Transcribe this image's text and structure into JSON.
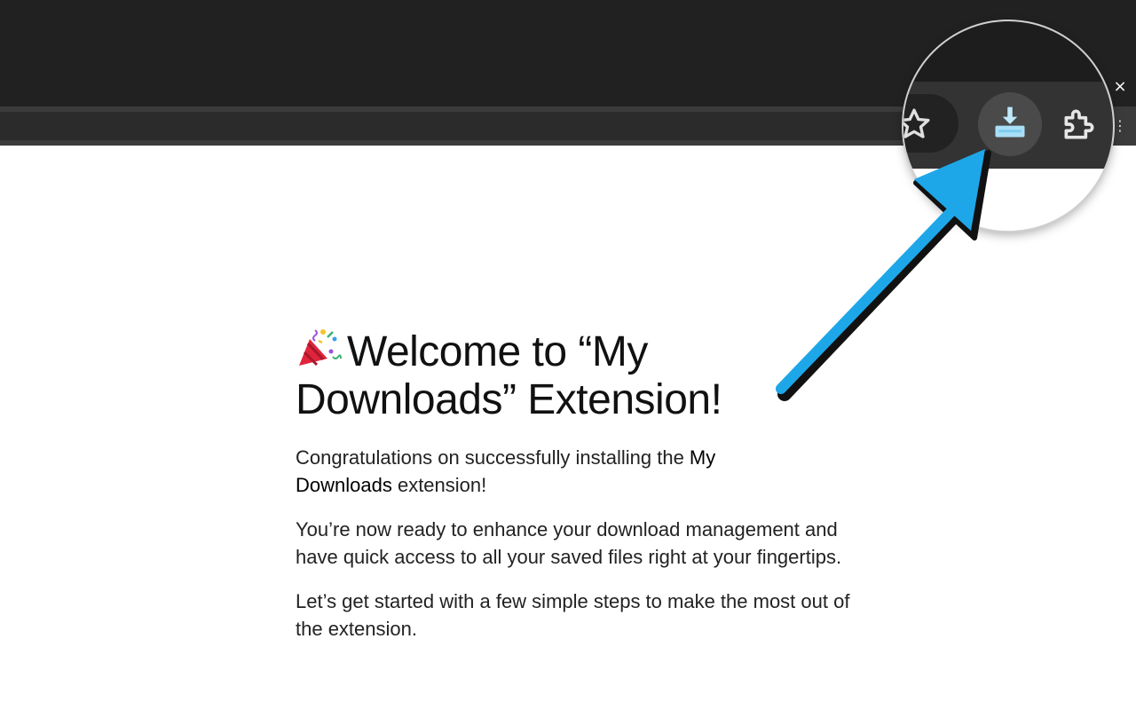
{
  "welcome": {
    "title": "Welcome to “My Downloads” Extension!",
    "congrats_prefix": "Congratulations on successfully installing the ",
    "extension_name": "My Downloads",
    "congrats_suffix": " extension!",
    "paragraph2": "You’re now ready to enhance your download management and have quick access to all your saved files right at your fingertips.",
    "paragraph3": "Let’s get started with a few simple steps to make the most out of the extension."
  },
  "browser": {
    "close_glyph": "×",
    "menu_glyph": "⋮"
  },
  "icons": {
    "heading": "party-popper-icon",
    "toolbar": [
      "star-icon",
      "download-icon",
      "puzzle-extension-icon"
    ],
    "pointer": "arrow-pointer"
  },
  "colors": {
    "accent_blue": "#1ea7e8",
    "chrome_dark": "#212121",
    "toolbar": "#3b3b3b"
  }
}
